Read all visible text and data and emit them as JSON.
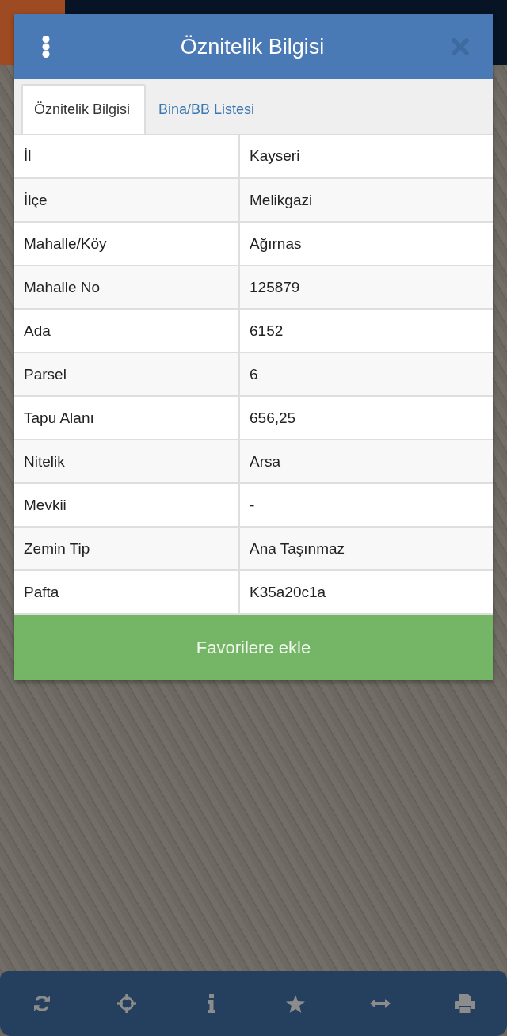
{
  "dialog": {
    "title": "Öznitelik Bilgisi"
  },
  "tabs": [
    {
      "label": "Öznitelik Bilgisi",
      "selected": true
    },
    {
      "label": "Bina/BB Listesi",
      "selected": false
    }
  ],
  "attributes": [
    {
      "label": "İl",
      "value": "Kayseri"
    },
    {
      "label": "İlçe",
      "value": "Melikgazi"
    },
    {
      "label": "Mahalle/Köy",
      "value": "Ağırnas"
    },
    {
      "label": "Mahalle No",
      "value": "125879"
    },
    {
      "label": "Ada",
      "value": "6152"
    },
    {
      "label": "Parsel",
      "value": "6"
    },
    {
      "label": "Tapu Alanı",
      "value": "656,25"
    },
    {
      "label": "Nitelik",
      "value": "Arsa"
    },
    {
      "label": "Mevkii",
      "value": "-"
    },
    {
      "label": "Zemin Tip",
      "value": "Ana Taşınmaz"
    },
    {
      "label": "Pafta",
      "value": "K35a20c1a"
    }
  ],
  "action_button": {
    "label": "Favorilere ekle"
  },
  "toolbar": {
    "buttons": [
      {
        "kind": "refresh"
      },
      {
        "kind": "locate"
      },
      {
        "kind": "info"
      },
      {
        "kind": "favorite"
      },
      {
        "kind": "measure"
      },
      {
        "kind": "print"
      }
    ]
  }
}
